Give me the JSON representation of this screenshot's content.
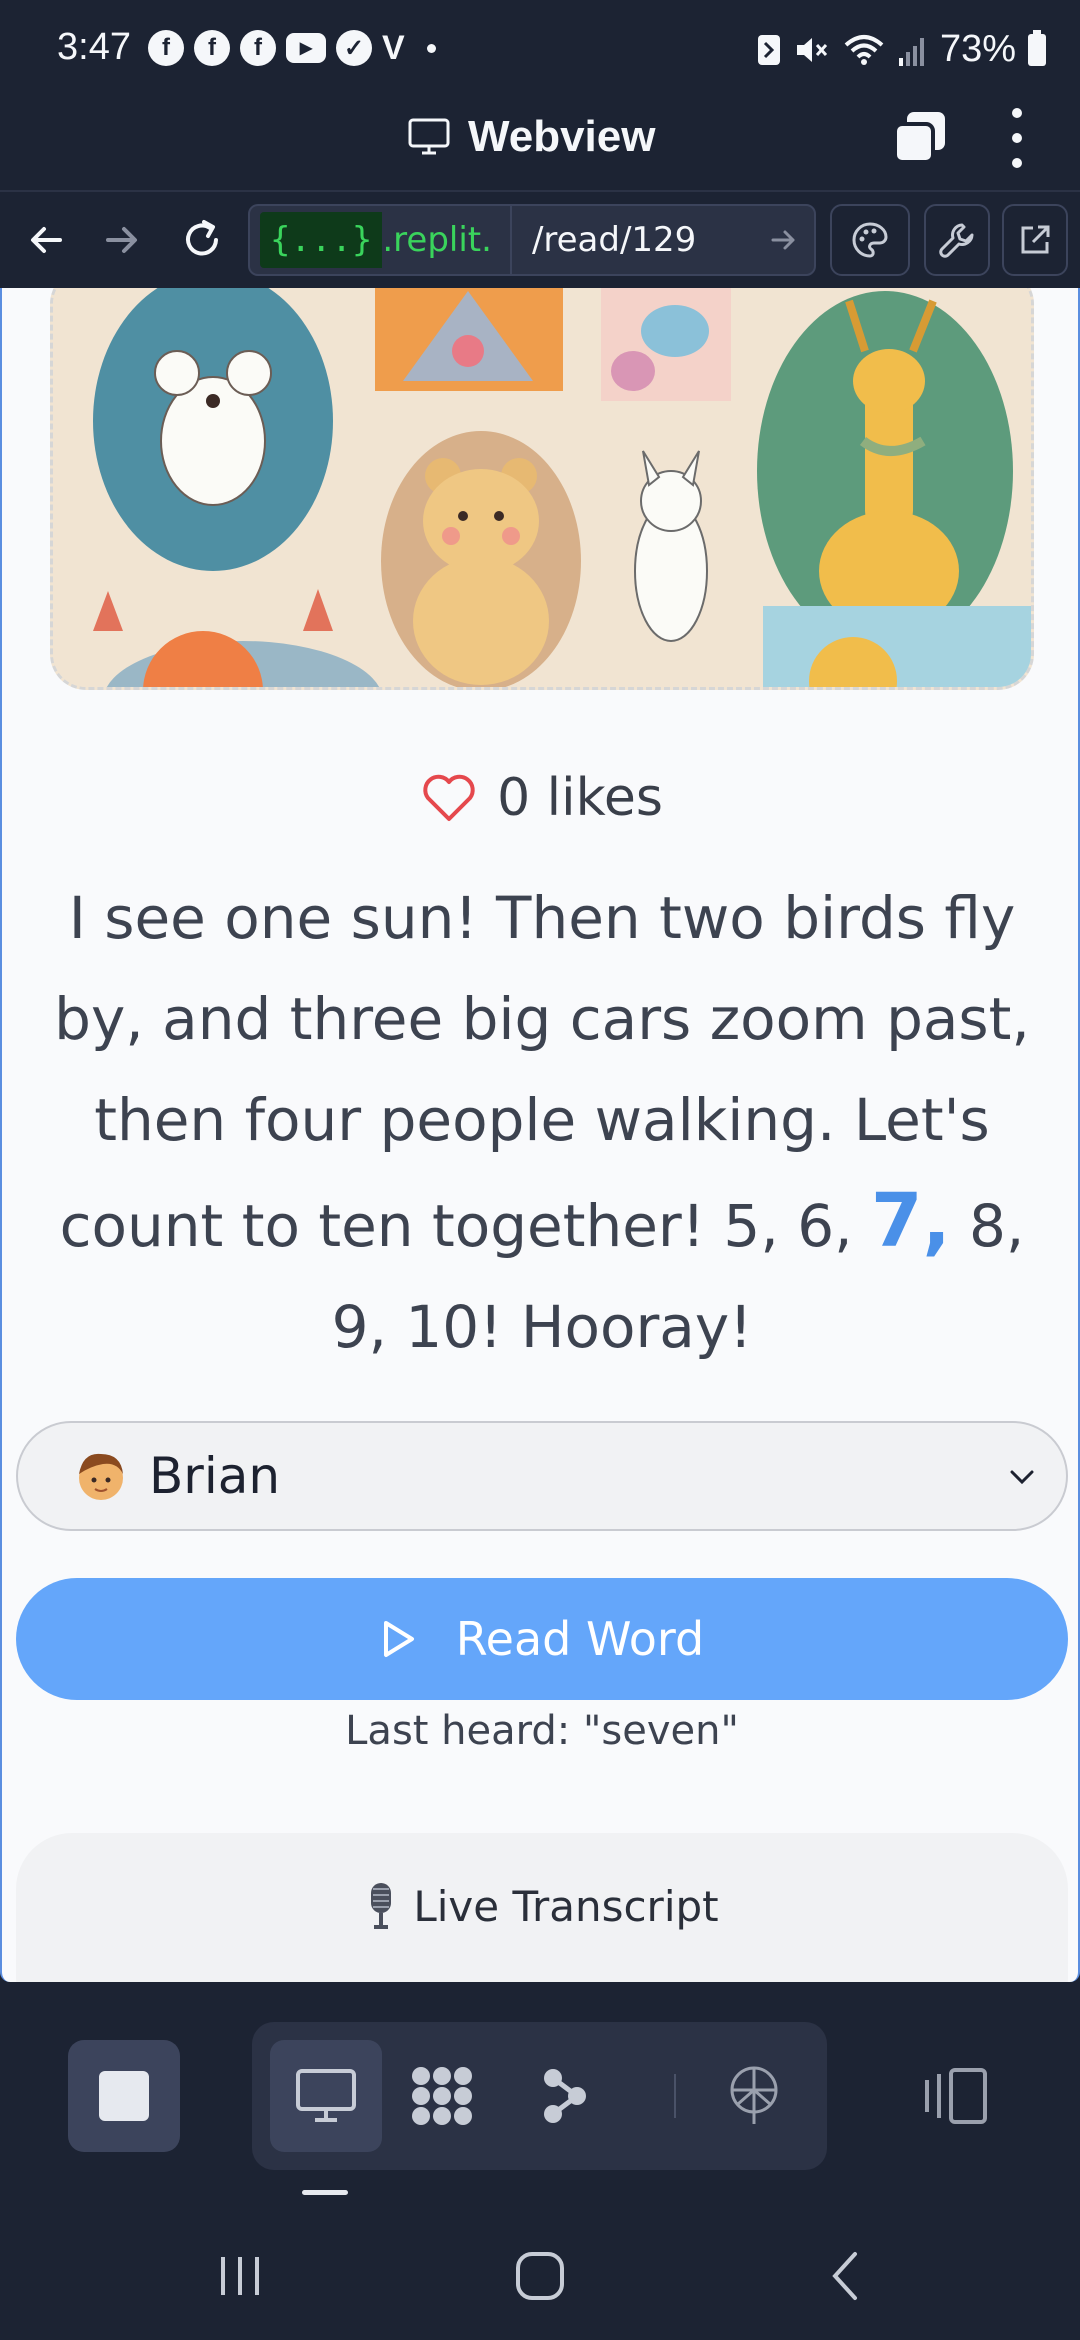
{
  "status_bar": {
    "time": "3:47",
    "notification_icons": [
      "facebook-icon",
      "facebook-icon",
      "facebook-icon",
      "youtube-icon",
      "check-badge-icon",
      "v-icon"
    ],
    "battery_percent": "73%"
  },
  "webview": {
    "title": "Webview",
    "url_host": "{...}",
    "url_host_suffix": ".replit.",
    "url_path": "/read/129"
  },
  "content": {
    "likes_text": "0 likes",
    "story_before": "I see one sun! Then two birds fly by, and three big cars zoom past, then four people walking. Let's count to ten together! 5, 6, ",
    "story_highlight": "7,",
    "story_after": " 8, 9, 10! Hooray!",
    "voice_name": "Brian",
    "read_button_label": "Read Word",
    "last_heard": "Last heard: \"seven\"",
    "transcript_title": "Live Transcript"
  },
  "colors": {
    "dark_bg": "#1c2333",
    "accent_blue": "#64a6fa",
    "highlight_blue": "#4a90e8",
    "replit_green": "#3ad45c",
    "heart_red": "#e5484d"
  }
}
